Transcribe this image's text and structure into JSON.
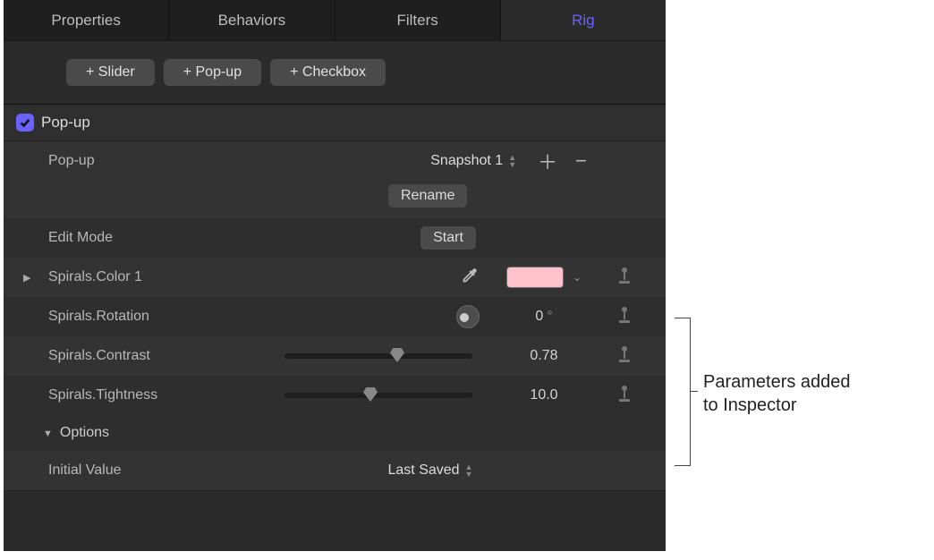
{
  "tabs": {
    "properties": "Properties",
    "behaviors": "Behaviors",
    "filters": "Filters",
    "rig": "Rig"
  },
  "add_buttons": {
    "slider": "+ Slider",
    "popup": "+ Pop-up",
    "checkbox": "+ Checkbox"
  },
  "popup_section": {
    "title": "Pop-up",
    "param_label": "Pop-up",
    "selected": "Snapshot 1",
    "rename": "Rename",
    "edit_mode_label": "Edit Mode",
    "start": "Start"
  },
  "params": {
    "color": {
      "label": "Spirals.Color 1",
      "swatch": "#ffc2cc"
    },
    "rotation": {
      "label": "Spirals.Rotation",
      "value": "0",
      "unit": "°"
    },
    "contrast": {
      "label": "Spirals.Contrast",
      "value": "0.78",
      "thumb_pct": 63
    },
    "tightness": {
      "label": "Spirals.Tightness",
      "value": "10.0",
      "thumb_pct": 48
    }
  },
  "options": {
    "header": "Options",
    "initial_value_label": "Initial Value",
    "initial_value": "Last Saved"
  },
  "annotation": {
    "line1": "Parameters added",
    "line2": "to Inspector"
  }
}
